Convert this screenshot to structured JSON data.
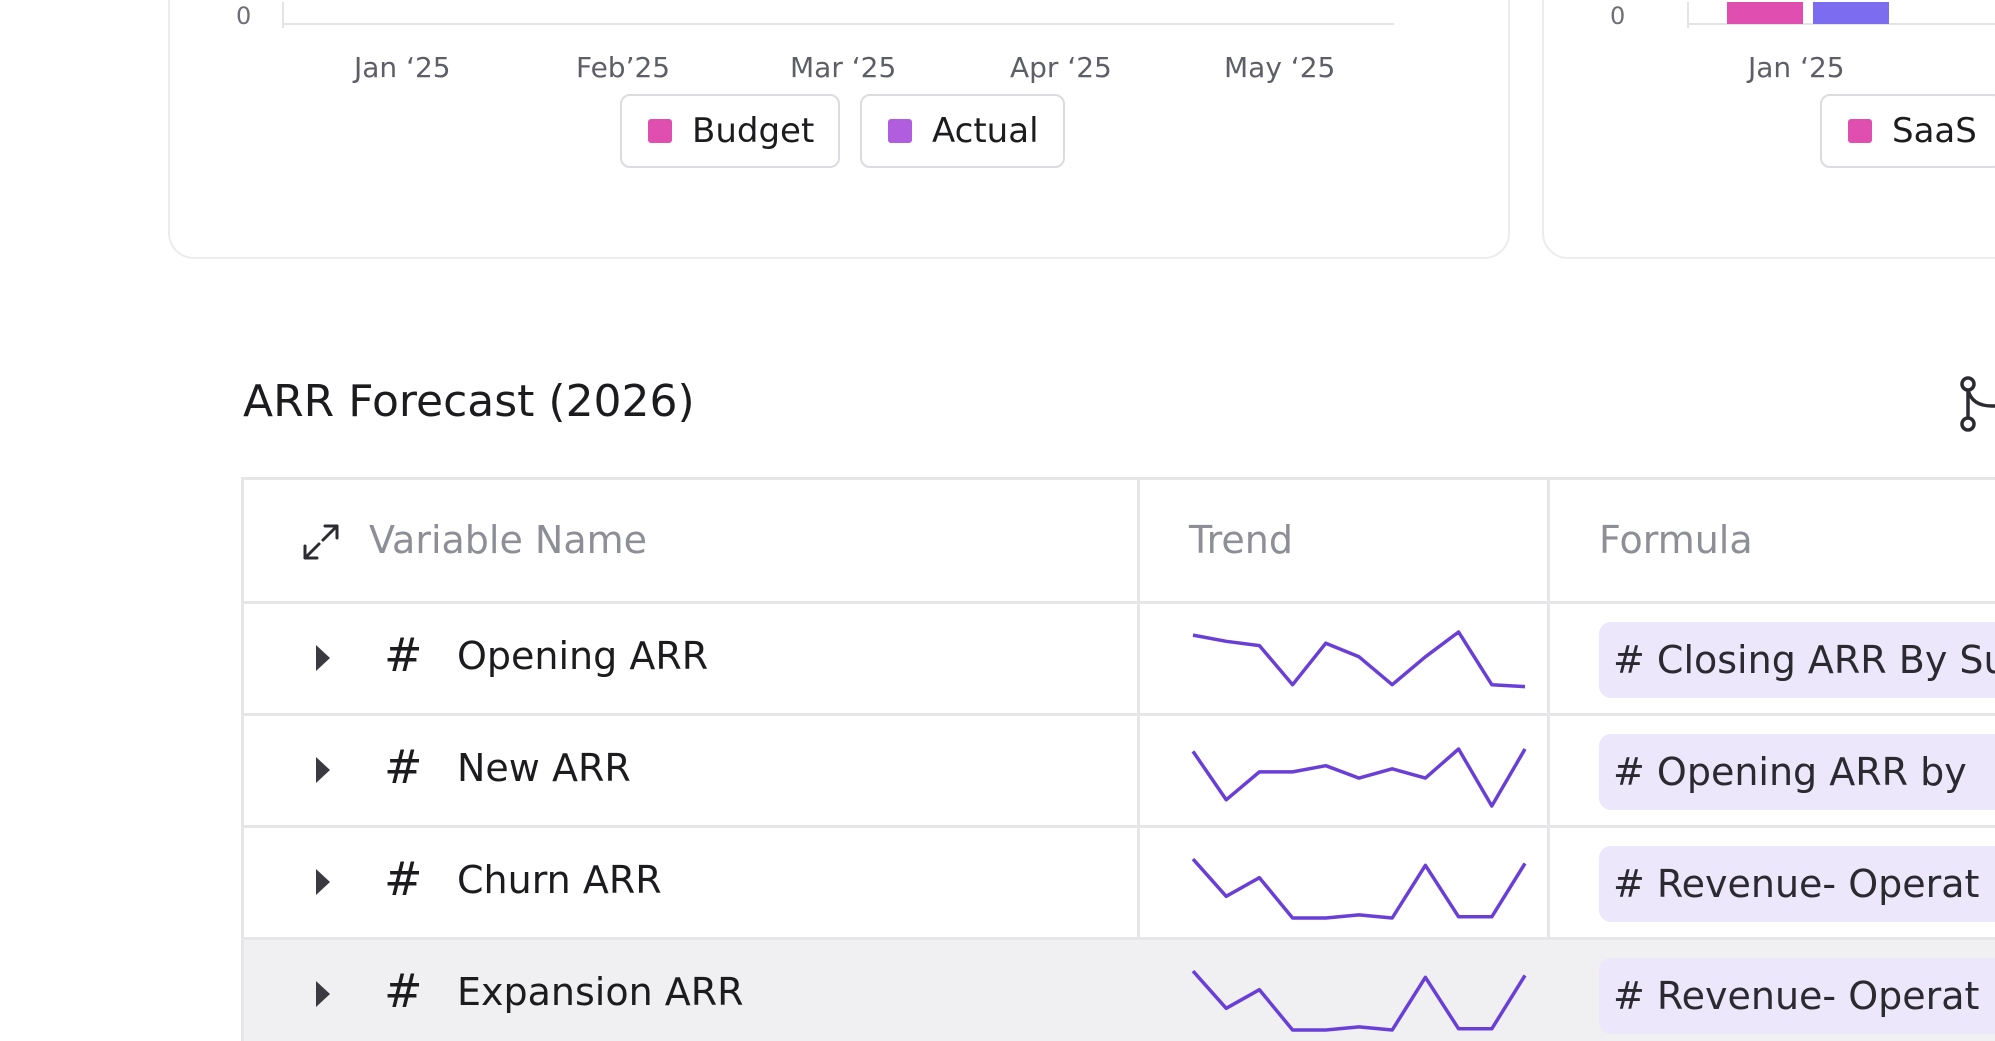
{
  "colors": {
    "budget": "#e04fb0",
    "actual": "#b15de0",
    "saas": "#e04fb0",
    "bar_blue": "#7b6cf0",
    "sparkline": "#6a3fd8",
    "formula_bg": "#ece7fb"
  },
  "chart_left": {
    "y_axis_zero": "0",
    "x_ticks": [
      "Jan ‘25",
      "Feb’25",
      "Mar ‘25",
      "Apr ‘25",
      "May ‘25"
    ],
    "legend": [
      {
        "label": "Budget",
        "color": "#e04fb0"
      },
      {
        "label": "Actual",
        "color": "#b15de0"
      }
    ]
  },
  "chart_right": {
    "y_axis_zero": "0",
    "x_ticks": [
      "Jan ‘25"
    ],
    "legend": [
      {
        "label": "SaaS",
        "color": "#e04fb0"
      }
    ]
  },
  "arr_section": {
    "title": "ARR Forecast (2026)",
    "branch_icon": "branch-icon",
    "table": {
      "expand_icon": "expand-arrows-icon",
      "columns": [
        "Variable Name",
        "Trend",
        "Formula"
      ],
      "rows": [
        {
          "type_icon": "#",
          "name": "Opening ARR",
          "formula": "# Closing ARR By Su",
          "trend": [
            0.95,
            0.85,
            0.78,
            0.15,
            0.82,
            0.6,
            0.15,
            0.6,
            1.0,
            0.15,
            0.12
          ]
        },
        {
          "type_icon": "#",
          "name": "New ARR",
          "formula": "# Opening ARR by",
          "trend": [
            0.88,
            0.1,
            0.55,
            0.55,
            0.65,
            0.45,
            0.6,
            0.45,
            0.92,
            0.0,
            0.92
          ]
        },
        {
          "type_icon": "#",
          "name": "Churn ARR",
          "formula": "# Revenue- Operat",
          "trend": [
            0.95,
            0.35,
            0.65,
            0.0,
            0.0,
            0.05,
            0.0,
            0.85,
            0.02,
            0.02,
            0.88
          ]
        },
        {
          "type_icon": "#",
          "name": "Expansion ARR",
          "formula": "# Revenue- Operat",
          "trend": [
            0.95,
            0.35,
            0.65,
            0.0,
            0.0,
            0.05,
            0.0,
            0.85,
            0.02,
            0.02,
            0.88
          ]
        }
      ]
    }
  }
}
